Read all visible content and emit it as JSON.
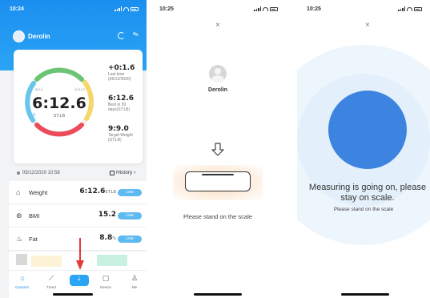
{
  "screen1": {
    "status_time": "10:24",
    "user_name": "Derolin",
    "gauge": {
      "value": "6:12.6",
      "unit": "ST:LB",
      "label_left": "8:5.4",
      "label_right": "10:12.2"
    },
    "stats": [
      {
        "value": "+0:1.6",
        "label": "Last time (05/12/2020)"
      },
      {
        "value": "6:12.6",
        "label": "Best in 30 days(ST:LB)"
      },
      {
        "value": "9:9.0",
        "label": "Target Weight (ST:LB)"
      }
    ],
    "measure_date": "05/12/2020 10:58",
    "history_label": "History",
    "metrics": [
      {
        "icon": "weight-icon",
        "name": "Weight",
        "value": "6:12.6",
        "unit": "ST:LB",
        "badge": "Low"
      },
      {
        "icon": "bmi-icon",
        "name": "BMI",
        "value": "15.2",
        "unit": "",
        "badge": "Low"
      },
      {
        "icon": "fat-icon",
        "name": "Fat",
        "value": "8.8",
        "unit": "%",
        "badge": "Low"
      }
    ],
    "tabs": [
      {
        "label": "Dynamic"
      },
      {
        "label": "Trend"
      },
      {
        "label": "Device"
      },
      {
        "label": "Me"
      }
    ],
    "colors": {
      "header": "#1b8ff0",
      "accent": "#2ba4f5",
      "badge": "#5fb9f1"
    }
  },
  "screen2": {
    "status_time": "10:25",
    "close": "×",
    "user_name": "Derolin",
    "instruction": "Please stand on the scale"
  },
  "screen3": {
    "status_time": "10:25",
    "close": "×",
    "title": "Measuring is going on, please stay on scale.",
    "subtitle": "Please stand on the scale",
    "colors": {
      "circle": "#3c84e0"
    }
  }
}
